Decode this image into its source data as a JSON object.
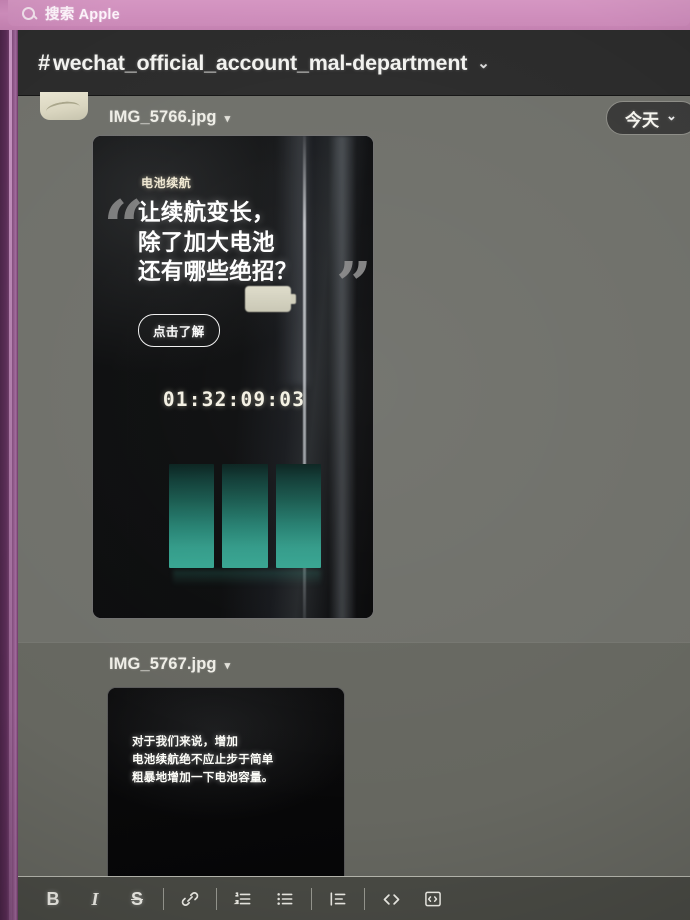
{
  "topbar": {
    "search_icon": "search-icon",
    "search_placeholder": "搜索 Apple"
  },
  "channel": {
    "hash": "#",
    "name": "wechat_official_account_mal-department",
    "chevron": "⌄"
  },
  "date_pill": {
    "label": "今天",
    "chevron": "⌄"
  },
  "attachments": [
    {
      "filename": "IMG_5766.jpg",
      "caret": "▾",
      "image": {
        "kicker": "电池续航",
        "quote_open": "“",
        "quote_close": "”",
        "headline_lines": [
          "让续航变长，",
          "除了加大电池",
          "还有哪些绝招？"
        ],
        "cta_label": "点击了解",
        "countdown": "01:32:09:03",
        "bar_color": "#2fa791",
        "bars": [
          100,
          100,
          100
        ]
      }
    },
    {
      "filename": "IMG_5767.jpg",
      "caret": "▾",
      "image": {
        "text_lines": [
          "对于我们来说，增加",
          "电池续航绝不应止步于简单",
          "粗暴地增加一下电池容量。"
        ]
      }
    }
  ],
  "composer_toolbar": {
    "items": [
      {
        "name": "bold-button",
        "glyph": "B",
        "style": "bold"
      },
      {
        "name": "italic-button",
        "glyph": "I",
        "style": "italic"
      },
      {
        "name": "strikethrough-button",
        "glyph": "S",
        "style": "strike"
      },
      {
        "name": "link-button",
        "glyph": "🔗",
        "style": "icon"
      },
      {
        "name": "ordered-list-button",
        "glyph": "",
        "style": "icon"
      },
      {
        "name": "bulleted-list-button",
        "glyph": "",
        "style": "icon"
      },
      {
        "name": "blockquote-button",
        "glyph": "",
        "style": "icon"
      },
      {
        "name": "code-button",
        "glyph": "</>",
        "style": "code"
      },
      {
        "name": "code-block-button",
        "glyph": "",
        "style": "icon"
      }
    ]
  },
  "theme": {
    "chrome_pink": "#cf88bb",
    "rail_purple": "#5d2b58",
    "panel_gray": "#6e6f68",
    "header_dark": "#2b2b2b",
    "accent_teal": "#2fa791"
  }
}
